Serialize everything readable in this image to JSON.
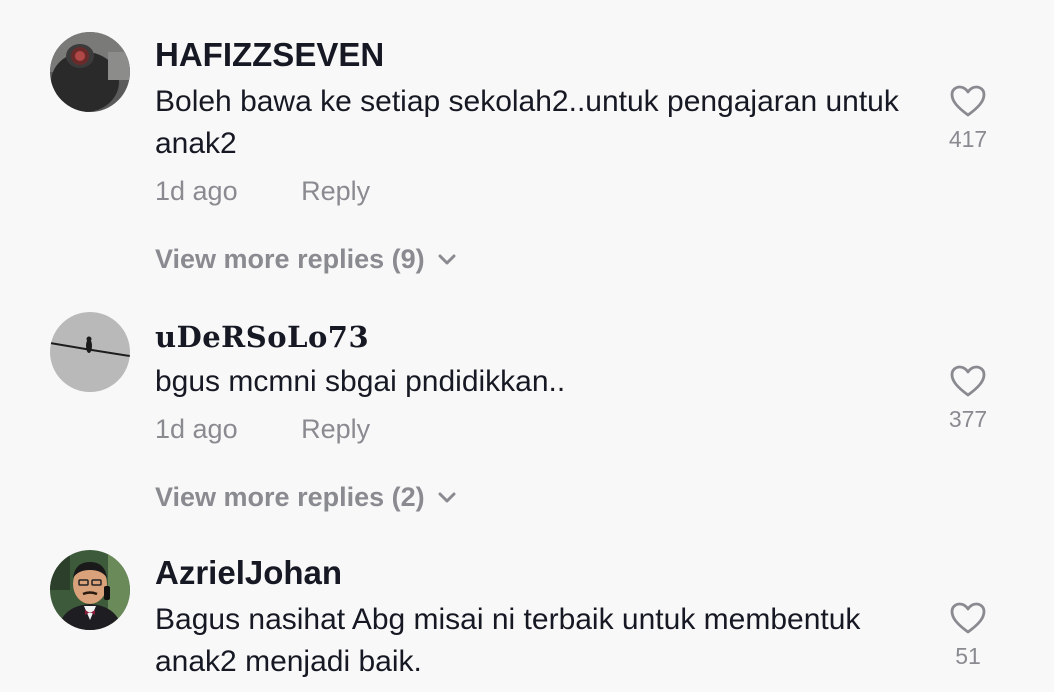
{
  "comments": [
    {
      "username": "HAFIZZSEVEN",
      "text": "Boleh bawa ke setiap sekolah2..untuk pengajaran untuk anak2",
      "time": "1d ago",
      "reply_label": "Reply",
      "likes": "417",
      "more_replies": "View more replies (9)",
      "avatar_icon": "avatar-dark-helmet"
    },
    {
      "username": "uDeRSoLo73",
      "text": "bgus mcmni sbgai pndidikkan..",
      "time": "1d ago",
      "reply_label": "Reply",
      "likes": "377",
      "more_replies": "View more replies (2)",
      "avatar_icon": "avatar-bird-on-wire"
    },
    {
      "username": "AzrielJohan",
      "text": "Bagus nasihat Abg misai ni terbaik untuk membentuk anak2 menjadi baik.",
      "likes": "51",
      "avatar_icon": "avatar-man-portrait"
    }
  ],
  "colors": {
    "background": "#f8f8f8",
    "text_primary": "#161823",
    "text_secondary": "#8a8b91"
  }
}
